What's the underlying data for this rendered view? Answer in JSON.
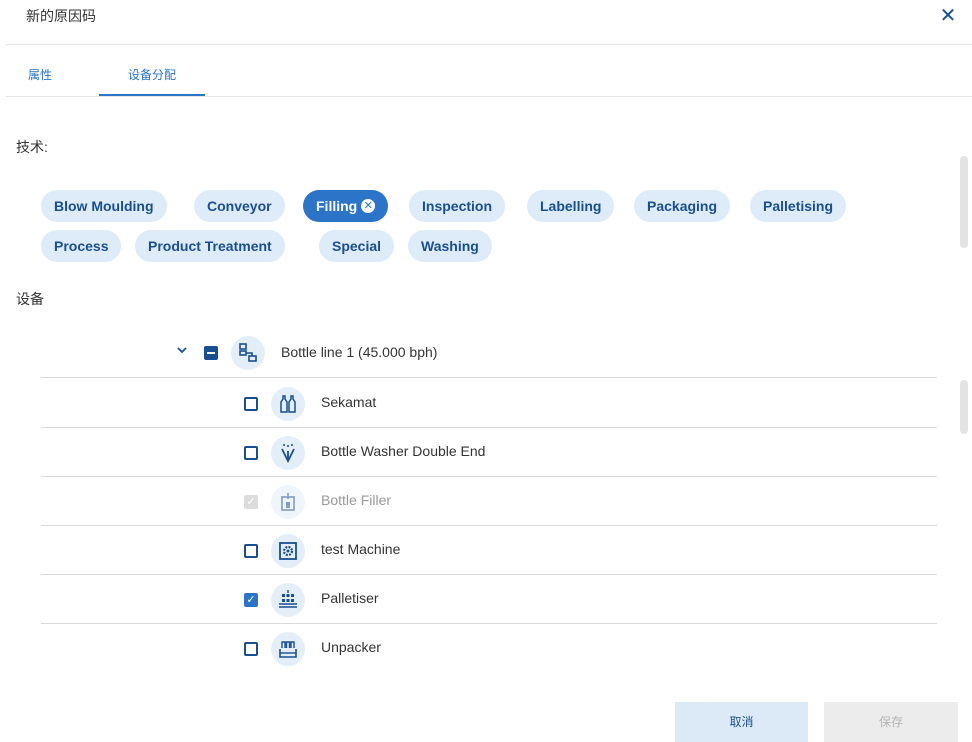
{
  "dialog": {
    "title": "新的原因码"
  },
  "tabs": [
    {
      "label": "属性",
      "active": false
    },
    {
      "label": "设备分配",
      "active": true
    }
  ],
  "technology": {
    "label": "技术:",
    "chips": [
      {
        "label": "Blow Moulding",
        "selected": false
      },
      {
        "label": "Conveyor",
        "selected": false
      },
      {
        "label": "Filling",
        "selected": true
      },
      {
        "label": "Inspection",
        "selected": false
      },
      {
        "label": "Labelling",
        "selected": false
      },
      {
        "label": "Packaging",
        "selected": false
      },
      {
        "label": "Palletising",
        "selected": false
      },
      {
        "label": "Process",
        "selected": false
      },
      {
        "label": "Product Treatment",
        "selected": false
      },
      {
        "label": "Special",
        "selected": false
      },
      {
        "label": "Washing",
        "selected": false
      }
    ]
  },
  "equipment": {
    "label": "设备",
    "line": {
      "name": "Bottle line 1 (45.000 bph)",
      "state": "indeterminate",
      "icon": "line-hierarchy-icon"
    },
    "machines": [
      {
        "name": "Sekamat",
        "state": "unchecked",
        "icon": "bottles-icon"
      },
      {
        "name": "Bottle Washer Double End",
        "state": "unchecked",
        "icon": "washer-spray-icon"
      },
      {
        "name": "Bottle Filler",
        "state": "disabled-checked",
        "icon": "filler-icon"
      },
      {
        "name": "test Machine",
        "state": "unchecked",
        "icon": "machine-gear-icon"
      },
      {
        "name": "Palletiser",
        "state": "checked",
        "icon": "palletiser-icon"
      },
      {
        "name": "Unpacker",
        "state": "unchecked",
        "icon": "unpacker-icon"
      }
    ]
  },
  "footer": {
    "cancel": "取消",
    "save": "保存"
  },
  "colors": {
    "primary": "#2b74c7",
    "dark": "#1a4f8f",
    "chip_bg": "#deebf8"
  }
}
